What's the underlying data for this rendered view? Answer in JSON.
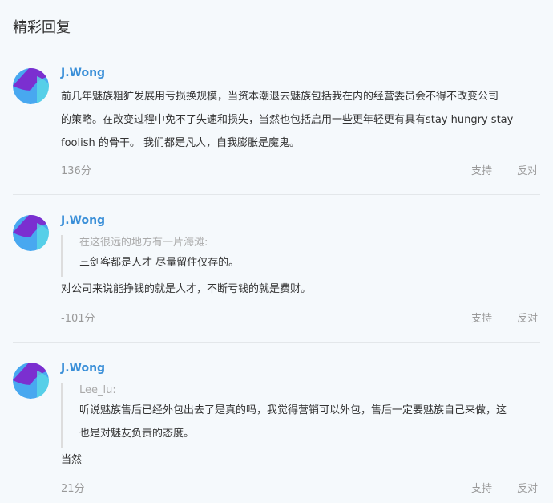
{
  "section_title": "精彩回复",
  "comments": [
    {
      "username": "J.Wong",
      "lines": [
        "前几年魅族粗犷发展用亏损换规模，当资本潮退去魅族包括我在内的经营委员会不得不改变公司",
        "的策略。在改变过程中免不了失速和损失，当然也包括启用一些更年轻更有具有stay hungry stay",
        "foolish 的骨干。 我们都是凡人，自我膨胀是魔鬼。"
      ],
      "score": "136分",
      "support": "支持",
      "oppose": "反对"
    },
    {
      "username": "J.Wong",
      "quote": {
        "author": "在这很远的地方有一片海滩:",
        "lines": [
          "三剑客都是人才 尽量留住仅存的。"
        ]
      },
      "lines": [
        "对公司来说能挣钱的就是人才，不断亏钱的就是费财。"
      ],
      "score": "-101分",
      "support": "支持",
      "oppose": "反对"
    },
    {
      "username": "J.Wong",
      "quote": {
        "author": "Lee_lu:",
        "lines": [
          "听说魅族售后已经外包出去了是真的吗，我觉得营销可以外包，售后一定要魅族自己来做，这",
          "也是对魅友负责的态度。"
        ]
      },
      "lines": [
        "当然"
      ],
      "score": "21分",
      "support": "支持",
      "oppose": "反对"
    }
  ],
  "colors": {
    "background": "#f5f9fc",
    "username": "#3a8fd8",
    "avatar_purple": "#7b2fd0",
    "avatar_blue": "#48a8f0",
    "avatar_teal": "#5ad8e6"
  },
  "icons": {
    "avatar": "user-avatar-icon"
  }
}
